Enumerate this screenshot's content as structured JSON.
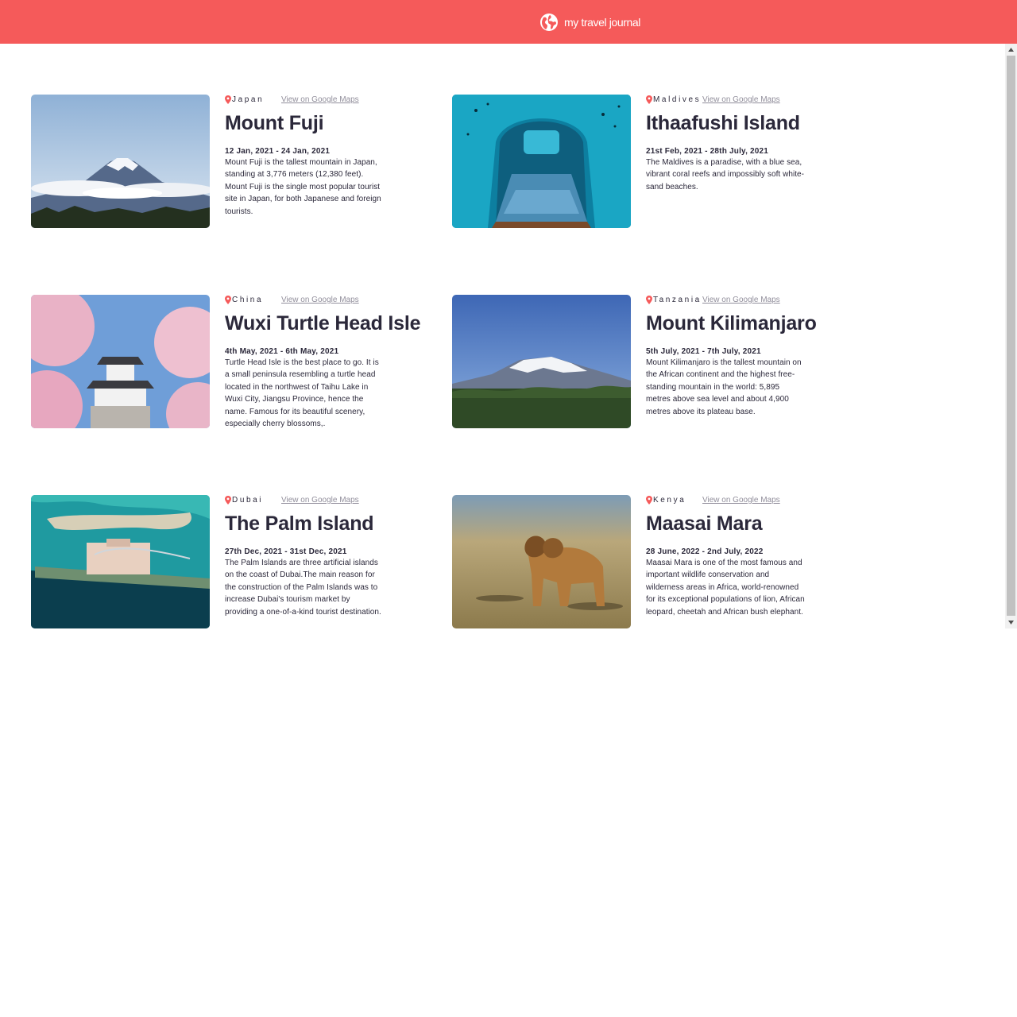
{
  "app": {
    "brand": "my travel journal",
    "brand_icon": "globe-icon",
    "accent": "#F55A5A"
  },
  "entries": [
    {
      "country": "Japan",
      "maps_link": "View on Google Maps",
      "title": "Mount Fuji",
      "dates": "12 Jan, 2021 - 24 Jan, 2021",
      "description": "Mount Fuji is the tallest mountain in Japan, standing at 3,776 meters (12,380 feet). Mount Fuji is the single most popular tourist site in Japan, for both Japanese and foreign tourists."
    },
    {
      "country": "Maldives",
      "maps_link": "View on Google Maps",
      "title": "Ithaafushi Island",
      "dates": "21st Feb, 2021 - 28th July, 2021",
      "description": "The Maldives is a paradise, with a blue sea, vibrant coral reefs and impossibly soft white-sand beaches."
    },
    {
      "country": "China",
      "maps_link": "View on Google Maps",
      "title": "Wuxi Turtle Head Isle",
      "dates": "4th May, 2021 - 6th May, 2021",
      "description": "Turtle Head Isle is the best place to go. It is a small peninsula resembling a turtle head located in the northwest of Taihu Lake in Wuxi City, Jiangsu Province, hence the name. Famous for its beautiful scenery, especially cherry blossoms,."
    },
    {
      "country": "Tanzania",
      "maps_link": "View on Google Maps",
      "title": "Mount Kilimanjaro",
      "dates": "5th July, 2021 - 7th July, 2021",
      "description": "Mount Kilimanjaro is the tallest mountain on the African continent and the highest free-standing mountain in the world: 5,895 metres above sea level and about 4,900 metres above its plateau base."
    },
    {
      "country": "Dubai",
      "maps_link": "View on Google Maps",
      "title": "The Palm Island",
      "dates": "27th Dec, 2021 - 31st Dec, 2021",
      "description": "The Palm Islands are three artificial islands on the coast of Dubai.The main reason for the construction of the Palm Islands was to increase Dubai's tourism market by providing a one-of-a-kind tourist destination."
    },
    {
      "country": "Kenya",
      "maps_link": "View on Google Maps",
      "title": "Maasai Mara",
      "dates": "28 June, 2022 - 2nd July, 2022",
      "description": "Maasai Mara is one of the most famous and important wildlife conservation and wilderness areas in Africa, world-renowned for its exceptional populations of lion, African leopard, cheetah and African bush elephant."
    }
  ]
}
